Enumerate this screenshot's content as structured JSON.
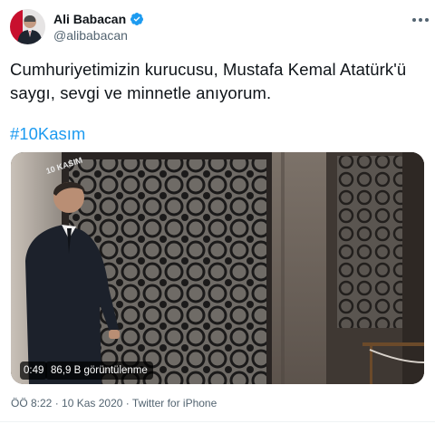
{
  "tweet": {
    "author": {
      "display_name": "Ali Babacan",
      "handle": "@alibabacan",
      "verified": true,
      "avatar_icon": "avatar"
    },
    "text": "Cumhuriyetimizin kurucusu, Mustafa Kemal Atatürk'ü saygı, sevgi ve minnetle anıyorum.",
    "hashtag": "#10Kasım",
    "media": {
      "type": "video",
      "duration": "0:49",
      "views": "86,9 B görüntülenme",
      "watermark": "10 KASIM"
    },
    "time": "ÖÖ 8:22",
    "date": "10 Kas 2020",
    "source": "Twitter for iPhone",
    "separator": "·"
  },
  "colors": {
    "accent": "#1d9bf0",
    "text": "#0f1419",
    "muted": "#536471"
  }
}
